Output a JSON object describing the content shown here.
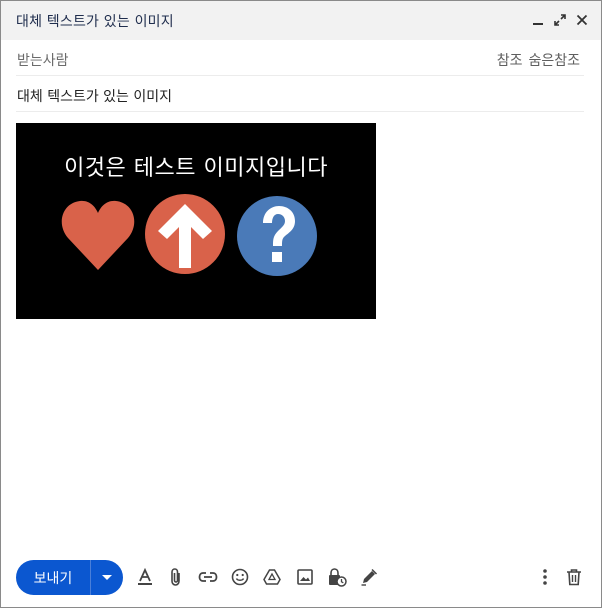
{
  "window": {
    "title": "대체 텍스트가 있는 이미지"
  },
  "recipients": {
    "to_label": "받는사람",
    "cc_label": "참조",
    "bcc_label": "숨은참조"
  },
  "subject": {
    "value": "대체 텍스트가 있는 이미지"
  },
  "body": {
    "image": {
      "caption": "이것은 테스트 이미지입니다",
      "symbols": [
        "heart-icon",
        "up-arrow-icon",
        "question-mark-icon"
      ],
      "colors": {
        "background": "#000000",
        "heart": "#d9624a",
        "arrow_circle": "#d9624a",
        "question_circle": "#4a7ab8"
      }
    }
  },
  "toolbar": {
    "send_label": "보내기",
    "accent_color": "#0b57d0",
    "icons": [
      "text-format-icon",
      "attach-icon",
      "link-icon",
      "emoji-icon",
      "drive-icon",
      "photo-icon",
      "confidential-lock-icon",
      "signature-pen-icon",
      "more-options-icon",
      "trash-icon"
    ]
  }
}
